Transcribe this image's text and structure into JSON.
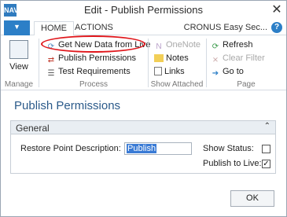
{
  "window": {
    "app_icon_text": "NAV",
    "title": "Edit - Publish Permissions",
    "close_glyph": "✕"
  },
  "ribbon_tabs": {
    "menu_glyph": "▼",
    "home": "HOME",
    "actions": "ACTIONS",
    "company": "CRONUS Easy Sec...",
    "help_glyph": "?"
  },
  "ribbon": {
    "manage": {
      "view_label": "View",
      "group_label": "Manage"
    },
    "process": {
      "items": [
        {
          "label": "Get New Data from Live",
          "icon": "refresh-data-icon"
        },
        {
          "label": "Publish Permissions",
          "icon": "publish-icon"
        },
        {
          "label": "Test Requirements",
          "icon": "test-icon"
        }
      ],
      "group_label": "Process"
    },
    "show_attached": {
      "items": [
        {
          "label": "OneNote",
          "icon": "onenote-icon"
        },
        {
          "label": "Notes",
          "icon": "notes-icon"
        },
        {
          "label": "Links",
          "icon": "links-icon"
        }
      ],
      "group_label": "Show Attached"
    },
    "page": {
      "items": [
        {
          "label": "Refresh",
          "icon": "refresh-icon"
        },
        {
          "label": "Clear Filter",
          "icon": "clear-filter-icon"
        },
        {
          "label": "Go to",
          "icon": "goto-arrow-icon"
        }
      ],
      "group_label": "Page"
    }
  },
  "page": {
    "title": "Publish Permissions",
    "general": {
      "header": "General",
      "collapse_glyph": "⌃",
      "restore_point_label": "Restore Point Description:",
      "restore_point_value": "Publish",
      "show_status_label": "Show Status:",
      "show_status_checked": false,
      "publish_to_live_label": "Publish to Live:",
      "publish_to_live_checked": true,
      "check_glyph": "✓"
    }
  },
  "footer": {
    "ok_label": "OK"
  },
  "colors": {
    "accent": "#2c7fc7",
    "title_blue": "#2b5a8a",
    "annotation_red": "#e0161b"
  }
}
